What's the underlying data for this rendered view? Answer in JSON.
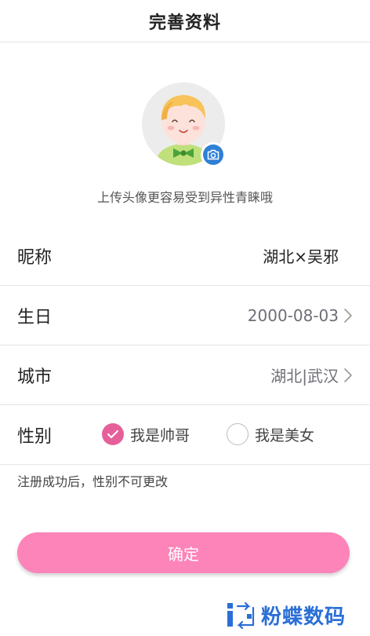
{
  "header": {
    "title": "完善资料"
  },
  "avatar": {
    "icon": "cartoon-boy-avatar",
    "camera_icon": "camera-icon",
    "accent": "#2f7fd6"
  },
  "avatar_hint": "上传头像更容易受到异性青睐哦",
  "fields": {
    "nickname": {
      "label": "昵称",
      "value": "湖北×吴邪"
    },
    "birthday": {
      "label": "生日",
      "value": "2000-08-03"
    },
    "city": {
      "label": "城市",
      "value": "湖北|武汉"
    },
    "gender": {
      "label": "性别",
      "options": [
        {
          "label": "我是帅哥",
          "selected": true
        },
        {
          "label": "我是美女",
          "selected": false
        }
      ]
    }
  },
  "gender_note": "注册成功后，性别不可更改",
  "confirm_label": "确定",
  "watermark": {
    "text": "粉蝶数码"
  },
  "colors": {
    "primary_button": "#fd84b9",
    "radio_checked": "#e5609a",
    "watermark": "#2a6fd6"
  }
}
